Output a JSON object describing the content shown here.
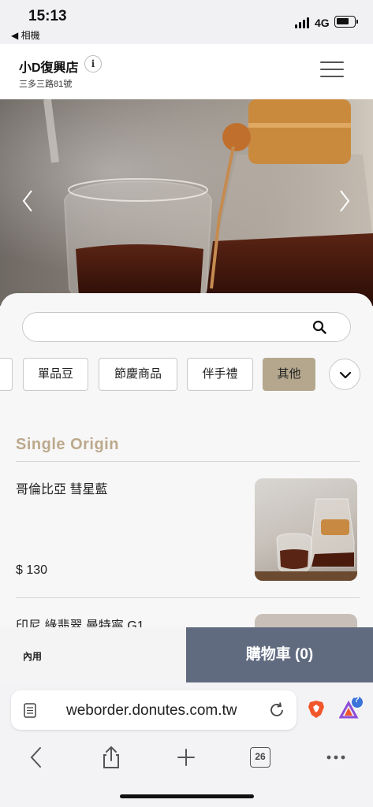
{
  "status_bar": {
    "time": "15:13",
    "back_app": "◀ 相機",
    "network": "4G"
  },
  "header": {
    "store_name": "小D復興店",
    "address": "三多三路81號"
  },
  "search": {
    "placeholder": ""
  },
  "categories": [
    {
      "label": "單品豆",
      "active": false
    },
    {
      "label": "節慶商品",
      "active": false
    },
    {
      "label": "伴手禮",
      "active": false
    },
    {
      "label": "其他",
      "active": true
    }
  ],
  "section": {
    "title": "Single Origin"
  },
  "products": [
    {
      "name": "哥倫比亞 彗星藍",
      "price": "$ 130"
    },
    {
      "name": "印尼 綠翡翠 曼特寧 G1",
      "price": ""
    }
  ],
  "bottom_bar": {
    "dine_in": "內用",
    "cart": "購物車 (0)"
  },
  "browser": {
    "url": "weborder.donutes.com.tw",
    "tab_count": "26",
    "badge": "?"
  },
  "colors": {
    "accent_gold": "#bca98c",
    "active_category": "#b4a78d",
    "cart_button": "#616b80"
  }
}
